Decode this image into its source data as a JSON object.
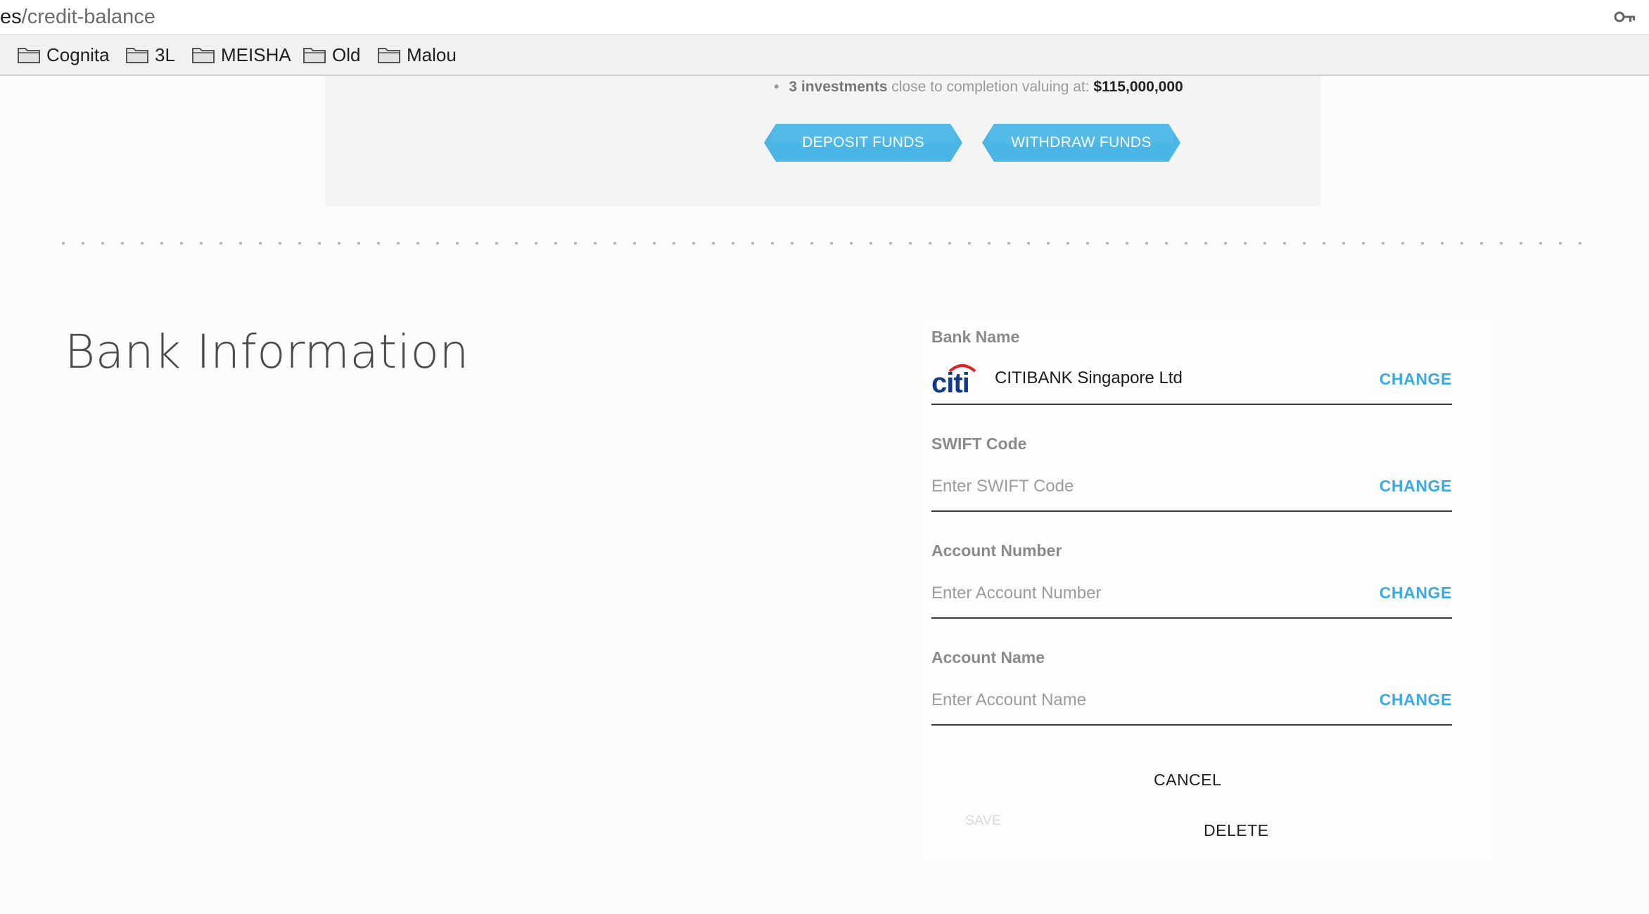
{
  "browser": {
    "url_host": "es",
    "url_path": "/credit-balance",
    "key_icon": "key-icon"
  },
  "bookmarks": [
    {
      "label": "Cognita",
      "icon": "folder-icon"
    },
    {
      "label": "3L",
      "icon": "folder-icon"
    },
    {
      "label": "MEISHA",
      "icon": "folder-icon"
    },
    {
      "label": "Old",
      "icon": "folder-icon"
    },
    {
      "label": "Malou",
      "icon": "folder-icon"
    }
  ],
  "funds": {
    "investments_strong": "3 investments",
    "investments_text": " close to completion valuing at: ",
    "investments_amount": "$115,000,000",
    "deposit_label": "DEPOSIT FUNDS",
    "withdraw_label": "WITHDRAW FUNDS"
  },
  "bank_section": {
    "title": "Bank Information",
    "bank_name": {
      "label": "Bank Name",
      "value": "CITIBANK Singapore Ltd",
      "logo": "citi-logo",
      "change_label": "CHANGE"
    },
    "swift": {
      "label": "SWIFT Code",
      "placeholder": "Enter SWIFT Code",
      "value": "",
      "change_label": "CHANGE"
    },
    "account_number": {
      "label": "Account Number",
      "placeholder": "Enter Account Number",
      "value": "",
      "change_label": "CHANGE"
    },
    "account_name": {
      "label": "Account Name",
      "placeholder": "Enter Account Name",
      "value": "",
      "change_label": "CHANGE"
    },
    "actions": {
      "cancel_label": "CANCEL",
      "save_label": "SAVE",
      "delete_label": "DELETE"
    }
  },
  "colors": {
    "accent": "#3aaadf",
    "ribbon": "#4ab6e6",
    "citi_blue": "#0f3a8a",
    "citi_red": "#d7262b"
  }
}
